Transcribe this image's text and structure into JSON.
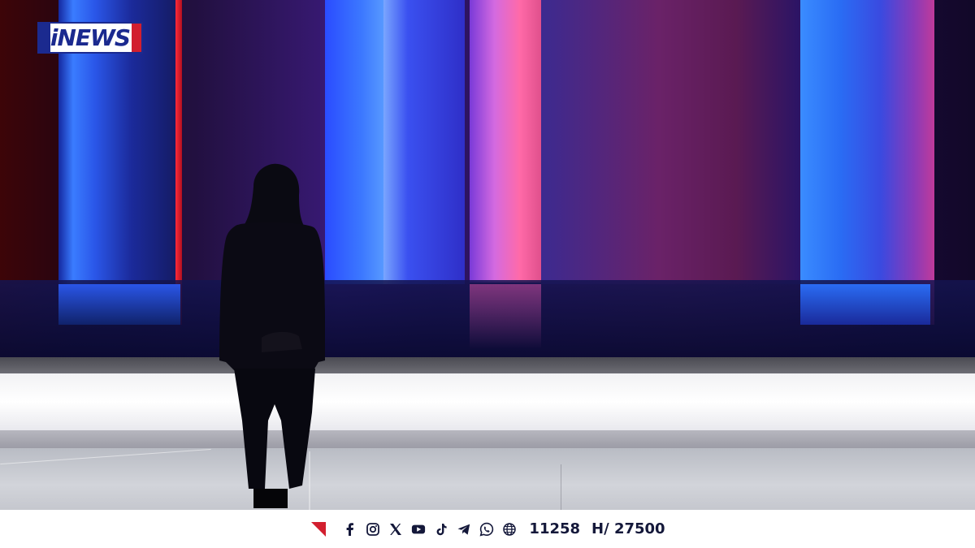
{
  "channel": {
    "logo_text": "iNEWS"
  },
  "ticker": {
    "social_icons": [
      "facebook-icon",
      "instagram-icon",
      "x-icon",
      "youtube-icon",
      "tiktok-icon",
      "telegram-icon",
      "whatsapp-icon",
      "globe-icon"
    ],
    "counter_left": "11258",
    "counter_right": "H/ 27500"
  },
  "colors": {
    "brand_blue": "#1b2a8f",
    "brand_red": "#d21f2f",
    "ticker_text": "#14183a"
  }
}
